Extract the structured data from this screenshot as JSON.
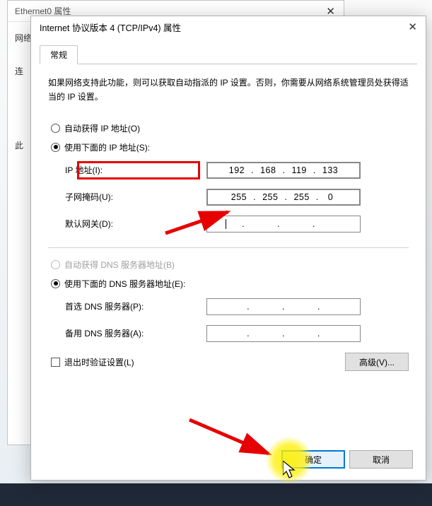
{
  "parent_window": {
    "title": "Ethernet0 属性",
    "group1": "网络",
    "label_connect": "连",
    "label_this": "此"
  },
  "dialog": {
    "title": "Internet 协议版本 4 (TCP/IPv4) 属性",
    "tab_general": "常规",
    "instructions": "如果网络支持此功能，则可以获取自动指派的 IP 设置。否则，你需要从网络系统管理员处获得适当的 IP 设置。",
    "radio_auto_ip": "自动获得 IP 地址(O)",
    "radio_manual_ip": "使用下面的 IP 地址(S):",
    "label_ip": "IP 地址(I):",
    "label_subnet": "子网掩码(U):",
    "label_gateway": "默认网关(D):",
    "radio_auto_dns": "自动获得 DNS 服务器地址(B)",
    "radio_manual_dns": "使用下面的 DNS 服务器地址(E):",
    "label_dns_pref": "首选 DNS 服务器(P):",
    "label_dns_alt": "备用 DNS 服务器(A):",
    "checkbox_validate": "退出时验证设置(L)",
    "btn_advanced": "高级(V)...",
    "btn_ok": "确定",
    "btn_cancel": "取消",
    "values": {
      "ip": [
        "192",
        "168",
        "119",
        "133"
      ],
      "subnet": [
        "255",
        "255",
        "255",
        "0"
      ],
      "gateway": [
        "",
        "",
        "",
        ""
      ],
      "dns_pref": [
        "",
        "",
        "",
        ""
      ],
      "dns_alt": [
        "",
        "",
        "",
        ""
      ]
    }
  },
  "annotation": {
    "color_highlight": "#e60000",
    "color_click": "#fff000"
  }
}
